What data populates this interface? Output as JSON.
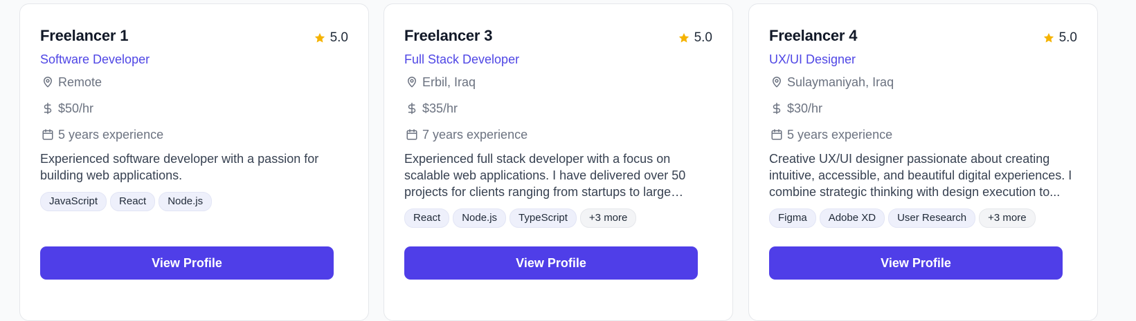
{
  "colors": {
    "accent": "#4f46e5",
    "button": "#4f3ee8",
    "star": "#f5b301",
    "tag_bg": "#eef0fb"
  },
  "cards": [
    {
      "name": "Freelancer 1",
      "rating": "5.0",
      "role": "Software Developer",
      "location": "Remote",
      "rate": "$50/hr",
      "experience": "5 years experience",
      "bio": "Experienced software developer with a passion for building web applications.",
      "skills": [
        "JavaScript",
        "React",
        "Node.js"
      ],
      "more": "",
      "button": "View Profile"
    },
    {
      "name": "Freelancer 3",
      "rating": "5.0",
      "role": "Full Stack Developer",
      "location": "Erbil, Iraq",
      "rate": "$35/hr",
      "experience": "7 years experience",
      "bio": "Experienced full stack developer with a focus on scalable web applications. I have delivered over 50 projects for clients ranging from startups to large enterprises. My...",
      "skills": [
        "React",
        "Node.js",
        "TypeScript"
      ],
      "more": "+3 more",
      "button": "View Profile"
    },
    {
      "name": "Freelancer 4",
      "rating": "5.0",
      "role": "UX/UI Designer",
      "location": "Sulaymaniyah, Iraq",
      "rate": "$30/hr",
      "experience": "5 years experience",
      "bio": "Creative UX/UI designer passionate about creating intuitive, accessible, and beautiful digital experiences. I combine strategic thinking with design execution to...",
      "skills": [
        "Figma",
        "Adobe XD",
        "User Research"
      ],
      "more": "+3 more",
      "button": "View Profile"
    }
  ],
  "icons": {
    "rating": "star-icon",
    "location": "map-pin-icon",
    "rate": "dollar-icon",
    "experience": "calendar-icon"
  }
}
